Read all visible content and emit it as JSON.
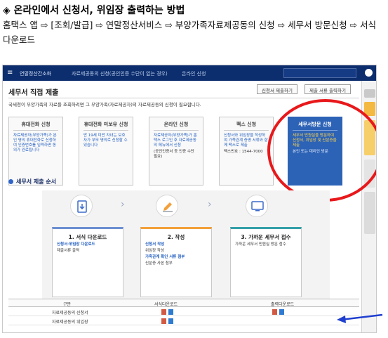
{
  "heading": "◈ 온라인에서 신청서, 위임장 출력하는 방법",
  "path_text": "홈택스 앱 ⇨ [조회/발급] ⇨ 연말정산서비스 ⇨ 부양가족자료제공동의 신청 ⇨ 세무서 방문신청 ⇨ 서식 다운로드",
  "screen": {
    "nav": {
      "menu_icon": "menu-icon",
      "home_label": "연말정산간소화",
      "crumb1": "자료제공동의 신청(공인인증 수단이 없는 경우)",
      "crumb2": "온라인 신청"
    },
    "page_title": "세무서 직접 제출",
    "top_buttons": [
      "신청서 제출하기",
      "제출 서류 출력하기"
    ],
    "intro": "국세청이 부양가족의 자료를 조회하려면 그 부양가족(자료제공자)의 자료제공동의 신청이 필요합니다.",
    "cards": [
      {
        "title": "휴대전화 신청",
        "body": "자료제공자(부양가족)가 본인 명의 휴대전화로 신청하여 인증번호를 입력하면 동의가 완료됩니다",
        "note": ""
      },
      {
        "title": "휴대전화 미보유 신청",
        "body": "만 19세 미만 자녀는 보호자가 부모 명의로 신청할 수 있습니다",
        "note": ""
      },
      {
        "title": "온라인 신청",
        "body": "자료제공자(부양가족)가 홈택스 로그인 후 자료제공동의 메뉴에서 신청",
        "note": "(공인인증서 등 인증 수단 필요)"
      },
      {
        "title": "팩스 신청",
        "body": "신청서와 위임장을 작성하여 가족관계 증명 서류와 함께 팩스로 제출",
        "note": "팩스번호 : 1544-7000"
      },
      {
        "title": "세무서방문 신청",
        "body": "세무서 민원실을 방문하여 신청서, 위임장 및 신분증을 제출",
        "note": "본인 또는 대리인 방문"
      }
    ],
    "section_title": "세무서 제출 순서",
    "steps": [
      {
        "title": "1. 서식 다운로드",
        "lines": [
          "신청서·위임장 다운로드",
          "제출서류 출력"
        ],
        "icon": "download-icon"
      },
      {
        "title": "2. 작성",
        "lines": [
          "신청서 작성",
          "위임장 작성",
          "가족관계 확인 서류 첨부",
          "신분증 사본 첨부"
        ],
        "icon": "pen-icon"
      },
      {
        "title": "3. 가까운 세무서 접수",
        "lines": [
          "가까운 세무서 민원실 방문 접수"
        ],
        "icon": "monitor-icon"
      }
    ],
    "table": {
      "headers": [
        "구분",
        "서식다운로드",
        "출력다운로드"
      ],
      "rows": [
        {
          "name": "자료제공동의 신청서"
        },
        {
          "name": "자료제공동의 위임장"
        }
      ]
    }
  },
  "colors": {
    "nav_bg": "#0d2e6e",
    "highlight_card": "#2d63b6",
    "annotation_ring": "#e8181b",
    "annotation_arrow": "#1f3fd0"
  }
}
